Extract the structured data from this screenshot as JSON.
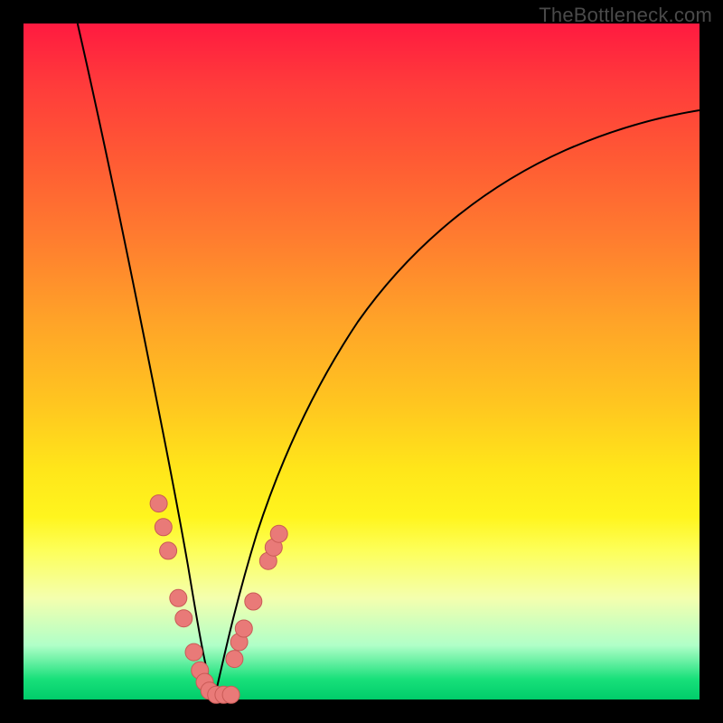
{
  "watermark": "TheBottleneck.com",
  "colors": {
    "frame": "#000000",
    "curve": "#000000",
    "marker_fill": "#e97a78",
    "marker_stroke": "#c95a56",
    "gradient_stops": [
      "#ff1a40",
      "#ff3b3b",
      "#ff5a34",
      "#ff7d2f",
      "#ffa328",
      "#ffc520",
      "#ffe61a",
      "#fff51e",
      "#fdff5a",
      "#f4ffae",
      "#b0ffc8",
      "#18e07a",
      "#00cc6a"
    ]
  },
  "chart_data": {
    "type": "line",
    "title": "",
    "xlabel": "",
    "ylabel": "",
    "xlim": [
      0,
      100
    ],
    "ylim": [
      0,
      100
    ],
    "series": [
      {
        "name": "left-branch",
        "x": [
          8,
          10,
          12,
          14,
          16,
          18,
          20,
          21.5,
          23,
          24.2,
          25.3,
          26.2,
          27,
          27.7,
          28.2
        ],
        "y": [
          100,
          87,
          74,
          62,
          50,
          39,
          29,
          22,
          16,
          11,
          7,
          4,
          2.3,
          1.1,
          0.5
        ]
      },
      {
        "name": "right-branch",
        "x": [
          28.2,
          29,
          30,
          31.2,
          32.6,
          34.5,
          37,
          40,
          44,
          49,
          55,
          62,
          70,
          79,
          89,
          100
        ],
        "y": [
          0.5,
          1.2,
          3,
          6,
          10,
          15.5,
          22.5,
          30,
          38.5,
          47,
          55,
          62.5,
          69.5,
          75.5,
          80.5,
          85
        ]
      }
    ],
    "markers": [
      {
        "branch": "left",
        "xy": [
          20.0,
          29.0
        ]
      },
      {
        "branch": "left",
        "xy": [
          20.7,
          25.5
        ]
      },
      {
        "branch": "left",
        "xy": [
          21.4,
          22.0
        ]
      },
      {
        "branch": "left",
        "xy": [
          22.9,
          15.0
        ]
      },
      {
        "branch": "left",
        "xy": [
          23.7,
          12.0
        ]
      },
      {
        "branch": "left",
        "xy": [
          25.2,
          7.0
        ]
      },
      {
        "branch": "left",
        "xy": [
          26.1,
          4.3
        ]
      },
      {
        "branch": "left",
        "xy": [
          26.8,
          2.6
        ]
      },
      {
        "branch": "left",
        "xy": [
          27.5,
          1.3
        ]
      },
      {
        "branch": "left",
        "xy": [
          28.5,
          0.7
        ]
      },
      {
        "branch": "left",
        "xy": [
          29.6,
          0.7
        ]
      },
      {
        "branch": "left",
        "xy": [
          30.7,
          0.7
        ]
      },
      {
        "branch": "right",
        "xy": [
          31.2,
          6.0
        ]
      },
      {
        "branch": "right",
        "xy": [
          31.9,
          8.5
        ]
      },
      {
        "branch": "right",
        "xy": [
          32.6,
          10.5
        ]
      },
      {
        "branch": "right",
        "xy": [
          34.0,
          14.5
        ]
      },
      {
        "branch": "right",
        "xy": [
          36.2,
          20.5
        ]
      },
      {
        "branch": "right",
        "xy": [
          37.0,
          22.5
        ]
      },
      {
        "branch": "right",
        "xy": [
          37.8,
          24.5
        ]
      }
    ]
  }
}
